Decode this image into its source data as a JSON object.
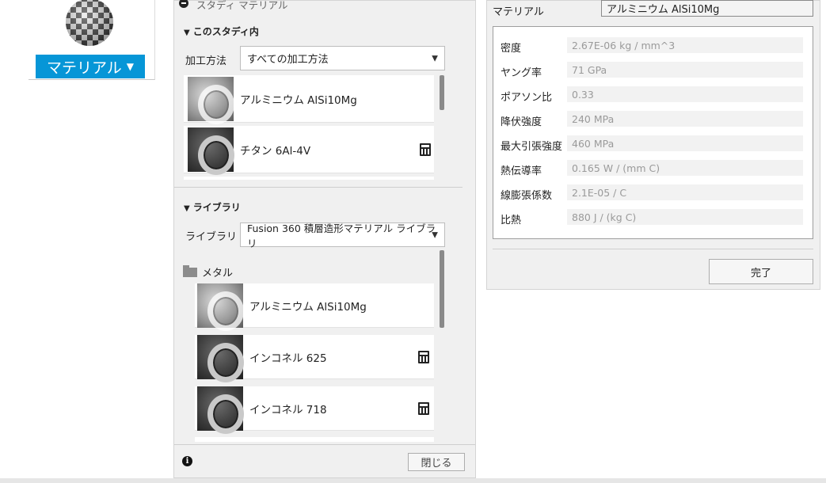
{
  "ribbon": {
    "material_button_label": "マテリアル",
    "icon": "checker-sphere-icon"
  },
  "browser": {
    "header_label": "スタディ マテリアル",
    "in_study": {
      "heading": "このスタディ内",
      "method_label": "加工方法",
      "method_value": "すべての加工方法",
      "items": [
        {
          "name": "アルミニウム AlSi10Mg",
          "calculator": false
        },
        {
          "name": "チタン 6Al-4V",
          "calculator": true
        }
      ]
    },
    "library": {
      "heading": "ライブラリ",
      "library_label": "ライブラリ",
      "library_value": "Fusion 360 積層造形マテリアル ライブラリ",
      "folder": "メタル",
      "items": [
        {
          "name": "アルミニウム AlSi10Mg",
          "calculator": false
        },
        {
          "name": "インコネル 625",
          "calculator": true
        },
        {
          "name": "インコネル 718",
          "calculator": true
        }
      ]
    },
    "close_label": "閉じる"
  },
  "properties": {
    "material_label": "マテリアル",
    "material_value": "アルミニウム AlSi10Mg",
    "rows": [
      {
        "label": "密度",
        "value": "2.67E-06 kg / mm^3"
      },
      {
        "label": "ヤング率",
        "value": "71 GPa"
      },
      {
        "label": "ポアソン比",
        "value": "0.33"
      },
      {
        "label": "降伏強度",
        "value": "240 MPa"
      },
      {
        "label": "最大引張強度",
        "value": "460 MPa"
      },
      {
        "label": "熱伝導率",
        "value": "0.165 W / (mm C)"
      },
      {
        "label": "線膨張係数",
        "value": "2.1E-05 / C"
      },
      {
        "label": "比熱",
        "value": "880 J / (kg C)"
      }
    ],
    "done_label": "完了"
  }
}
